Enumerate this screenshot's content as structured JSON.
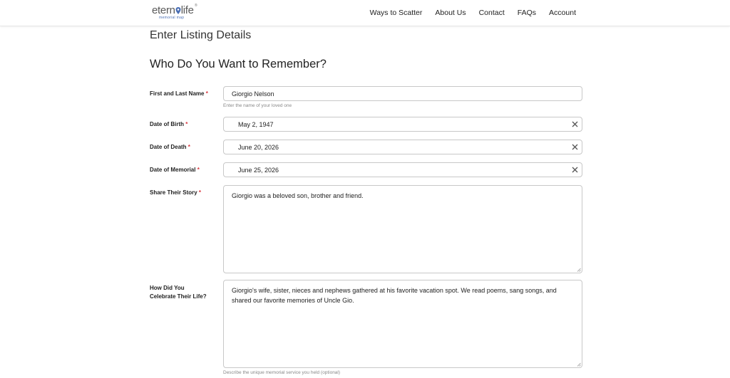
{
  "brand": {
    "name_main": "etern",
    "name_life": "life",
    "tm": "®",
    "tagline": "memorial map"
  },
  "nav": [
    {
      "label": "Ways to Scatter"
    },
    {
      "label": "About Us"
    },
    {
      "label": "Contact"
    },
    {
      "label": "FAQs"
    },
    {
      "label": "Account"
    }
  ],
  "page": {
    "title": "Enter Listing Details",
    "section_title": "Who Do You Want to Remember?"
  },
  "form": {
    "required_mark": "*",
    "name": {
      "label": "First and Last Name",
      "value": "Giorgio Nelson",
      "help": "Enter the name of your loved one"
    },
    "dob": {
      "label": "Date of Birth",
      "value": "May 2, 1947"
    },
    "dod": {
      "label": "Date of Death",
      "value": "June 20, 2026"
    },
    "dom": {
      "label": "Date of Memorial",
      "value": "June 25, 2026"
    },
    "story": {
      "label": "Share Their Story",
      "value": "Giorgio was a beloved son, brother and friend."
    },
    "celebrate": {
      "label_line1": "How Did You",
      "label_line2": "Celebrate Their Life?",
      "value": "Giorgio's wife, sister, nieces and nephews gathered at his favorite vacation spot. We read poems, sang songs, and shared our favorite memories of Uncle Gio.",
      "help": "Describe the unique memorial service you held (optional)"
    }
  },
  "colors": {
    "required": "#d9363e",
    "brand_blue": "#4a6fb5"
  }
}
